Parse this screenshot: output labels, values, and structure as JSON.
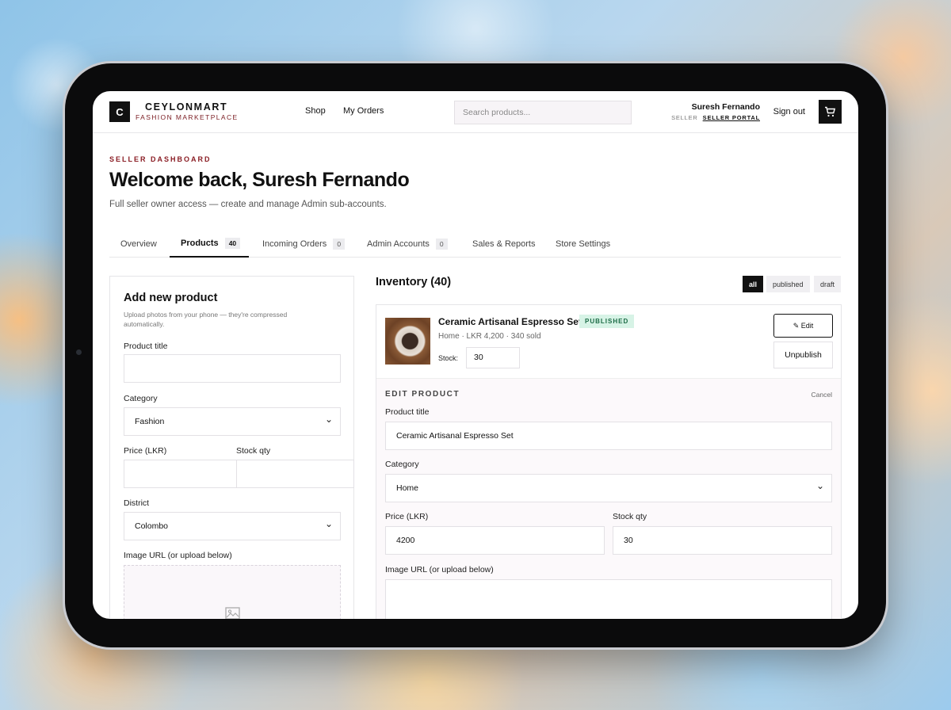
{
  "nav": {
    "logo_letter": "C",
    "brand_name": "CEYLONMART",
    "brand_sub": "FASHION MARKETPLACE",
    "links": [
      "Shop",
      "My Orders"
    ],
    "search_placeholder": "Search products...",
    "user_name": "Suresh Fernando",
    "user_role": "SELLER",
    "portal_link": "SELLER PORTAL",
    "signout": "Sign out",
    "cart_icon": "cart-icon"
  },
  "header": {
    "eyebrow": "SELLER DASHBOARD",
    "title": "Welcome back, Suresh Fernando",
    "subtitle": "Full seller owner access — create and manage Admin sub-accounts."
  },
  "tabs": [
    {
      "label": "Overview",
      "count": null
    },
    {
      "label": "Products",
      "count": "40"
    },
    {
      "label": "Incoming Orders",
      "count": "0"
    },
    {
      "label": "Admin Accounts",
      "count": "0"
    },
    {
      "label": "Sales & Reports",
      "count": null
    },
    {
      "label": "Store Settings",
      "count": null
    }
  ],
  "add_product": {
    "title": "Add new product",
    "helper": "Upload photos from your phone — they're compressed automatically.",
    "product_title_label": "Product title",
    "product_title_value": "",
    "category_label": "Category",
    "category_value": "Fashion",
    "price_label": "Price (LKR)",
    "price_value": "",
    "stock_label": "Stock qty",
    "stock_value": "",
    "district_label": "District",
    "district_value": "Colombo",
    "image_label": "Image URL (or upload below)",
    "upload_icon": "image-icon"
  },
  "inventory": {
    "title": "Inventory (40)",
    "filters": [
      "all",
      "published",
      "draft"
    ],
    "active_filter": "all",
    "product": {
      "name": "Ceramic Artisanal Espresso Set",
      "status": "PUBLISHED",
      "meta": "Home · LKR 4,200 · 340 sold",
      "stock_label": "Stock:",
      "stock_value": "30",
      "edit_label": "✎ Edit",
      "unpublish_label": "Unpublish"
    },
    "edit": {
      "heading": "EDIT PRODUCT",
      "cancel": "Cancel",
      "title_label": "Product title",
      "title_value": "Ceramic Artisanal Espresso Set",
      "category_label": "Category",
      "category_value": "Home",
      "price_label": "Price (LKR)",
      "price_value": "4200",
      "stock_label": "Stock qty",
      "stock_value": "30",
      "image_label": "Image URL (or upload below)",
      "image_value": ""
    }
  }
}
